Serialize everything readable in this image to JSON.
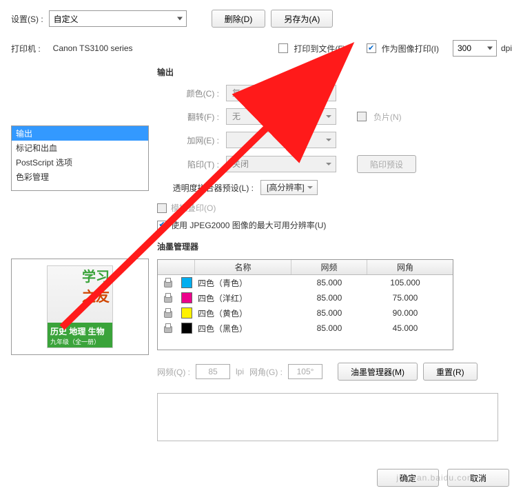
{
  "settings": {
    "label": "设置(S) :",
    "preset": "自定义",
    "delete_btn": "删除(D)",
    "saveas_btn": "另存为(A)"
  },
  "printer": {
    "label": "打印机 :",
    "name": "Canon TS3100 series",
    "print_to_file": "打印到文件(F)",
    "print_as_image": "作为图像打印(I)",
    "dpi_value": "300",
    "dpi_label": "dpi"
  },
  "sidebar": {
    "items": [
      "输出",
      "标记和出血",
      "PostScript 选项",
      "色彩管理"
    ]
  },
  "output": {
    "section": "输出",
    "color_label": "颜色(C) :",
    "color_value": "复合色",
    "flip_label": "翻转(F) :",
    "flip_value": "无",
    "negative": "负片(N)",
    "screen_label": "加网(E) :",
    "trap_label": "陷印(T) :",
    "trap_value": "关闭",
    "trap_preset_btn": "陷印预设",
    "transparency_label": "透明度拼合器预设(L) :",
    "transparency_value": "[高分辨率]",
    "simulate": "模拟叠印(O)",
    "jpeg2000": "使用 JPEG2000 图像的最大可用分辨率(U)"
  },
  "ink": {
    "section": "油墨管理器",
    "headers": {
      "name": "名称",
      "freq": "网频",
      "angle": "网角"
    },
    "rows": [
      {
        "swatch": "#00AEEF",
        "name": "四色（青色）",
        "freq": "85.000",
        "angle": "105.000"
      },
      {
        "swatch": "#EC008C",
        "name": "四色（洋红）",
        "freq": "85.000",
        "angle": "75.000"
      },
      {
        "swatch": "#FFF200",
        "name": "四色（黄色）",
        "freq": "85.000",
        "angle": "90.000"
      },
      {
        "swatch": "#000000",
        "name": "四色（黑色）",
        "freq": "85.000",
        "angle": "45.000"
      }
    ],
    "freq_label": "网频(Q) :",
    "freq_value": "85",
    "lpi": "lpi",
    "angle_label": "网角(G) :",
    "angle_value": "105°",
    "ink_manager_btn": "油墨管理器(M)",
    "reset_btn": "重置(R)"
  },
  "preview": {
    "title1": "学习",
    "title2": "之友",
    "band": "历史 地理 生物",
    "band2": "九年级（全一册）"
  },
  "footer": {
    "ok": "确定",
    "cancel": "取消"
  },
  "watermark": "jingyan.baidu.com"
}
